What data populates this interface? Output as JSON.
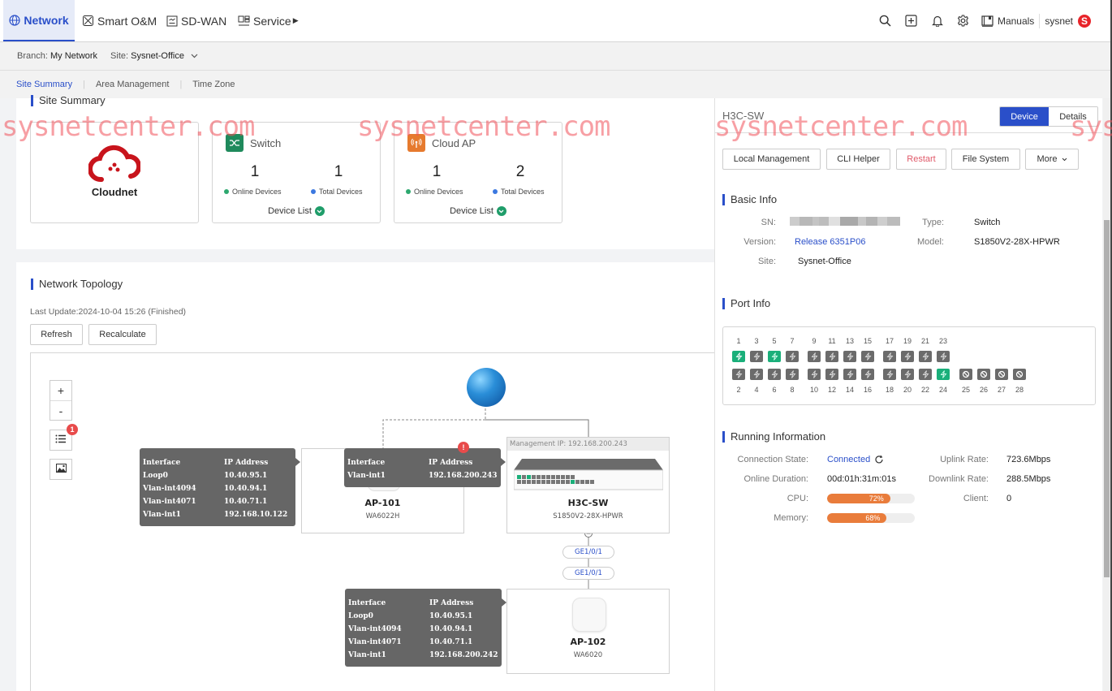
{
  "topnav": {
    "items": [
      {
        "label": "Network",
        "icon": "globe-icon",
        "active": true
      },
      {
        "label": "Smart O&M",
        "icon": "smart-om-icon"
      },
      {
        "label": "SD-WAN",
        "icon": "sdwan-icon"
      },
      {
        "label": "Service",
        "icon": "service-icon"
      }
    ],
    "manuals_label": "Manuals",
    "user_name": "sysnet",
    "user_badge": "S"
  },
  "branchbar": {
    "branch_label": "Branch:",
    "branch_value": "My Network",
    "site_label": "Site:",
    "site_value": "Sysnet-Office"
  },
  "subtabs": [
    "Site Summary",
    "Area Management",
    "Time Zone"
  ],
  "site_summary": {
    "title": "Site Summary",
    "logo_text": "Cloudnet",
    "cards": [
      {
        "name": "Switch",
        "online": "1",
        "total": "1",
        "online_label": "Online Devices",
        "total_label": "Total Devices",
        "device_list": "Device List"
      },
      {
        "name": "Cloud AP",
        "online": "1",
        "total": "2",
        "online_label": "Online Devices",
        "total_label": "Total Devices",
        "device_list": "Device List"
      }
    ]
  },
  "topology": {
    "title": "Network Topology",
    "last_update": "Last Update:2024-10-04 15:26 (Finished)",
    "refresh_label": "Refresh",
    "recalculate_label": "Recalculate",
    "zoom_in": "+",
    "zoom_out": "-",
    "list_badge": "1",
    "nodes": [
      {
        "name": "AP-101",
        "model": "WA6022H"
      },
      {
        "name": "H3C-SW",
        "model": "S1850V2-28X-HPWR",
        "mgmt_ip": "Management IP: 192.168.200.243"
      },
      {
        "name": "AP-102",
        "model": "WA6020"
      }
    ],
    "links": [
      {
        "from_port": "GE1/0/1",
        "to_port": "GE1/0/1"
      }
    ],
    "tooltips": [
      {
        "headers": [
          "Interface",
          "IP Address"
        ],
        "rows": [
          [
            "Loop0",
            "10.40.95.1"
          ],
          [
            "Vlan-int4094",
            "10.40.94.1"
          ],
          [
            "Vlan-int4071",
            "10.40.71.1"
          ],
          [
            "Vlan-int1",
            "192.168.10.122"
          ]
        ]
      },
      {
        "headers": [
          "Interface",
          "IP Address"
        ],
        "rows": [
          [
            "Vlan-int1",
            "192.168.200.243"
          ]
        ]
      },
      {
        "headers": [
          "Interface",
          "IP Address"
        ],
        "rows": [
          [
            "Loop0",
            "10.40.95.1"
          ],
          [
            "Vlan-int4094",
            "10.40.94.1"
          ],
          [
            "Vlan-int4071",
            "10.40.71.1"
          ],
          [
            "Vlan-int1",
            "192.168.200.242"
          ]
        ]
      }
    ]
  },
  "panel": {
    "device_name": "H3C-SW",
    "tabs": [
      "Device",
      "Details"
    ],
    "actions": [
      "Local Management",
      "CLI Helper",
      "Restart",
      "File System",
      "More"
    ],
    "basic_info": {
      "title": "Basic Info",
      "sn_label": "SN:",
      "type_label": "Type:",
      "type": "Switch",
      "version_label": "Version:",
      "version": "Release 6351P06",
      "model_label": "Model:",
      "model": "S1850V2-28X-HPWR",
      "site_label": "Site:",
      "site": "Sysnet-Office"
    },
    "port_info": {
      "title": "Port Info",
      "ports_up": [
        1,
        5,
        24
      ],
      "poe_ports": 24,
      "fiber_ports": [
        25,
        26,
        27,
        28
      ]
    },
    "running": {
      "title": "Running Information",
      "connection_label": "Connection State:",
      "connection": "Connected",
      "duration_label": "Online Duration:",
      "duration": "00d:01h:31m:01s",
      "cpu_label": "CPU:",
      "cpu_percent": 72,
      "cpu_text": "72%",
      "memory_label": "Memory:",
      "memory_percent": 68,
      "memory_text": "68%",
      "uplink_label": "Uplink Rate:",
      "uplink": "723.6Mbps",
      "downlink_label": "Downlink Rate:",
      "downlink": "288.5Mbps",
      "client_label": "Client:",
      "client": "0"
    }
  },
  "watermark": "sysnetcenter.com",
  "colors": {
    "accent": "#2a4fc9",
    "online": "#1aaf7a",
    "bar": "#e97c3b",
    "danger": "#e8242a"
  }
}
